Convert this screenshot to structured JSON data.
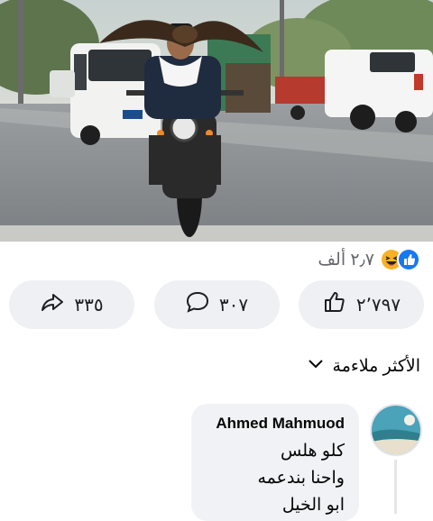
{
  "post_photo": {
    "alt_subject": "man-on-motorcycle-with-eagle",
    "colors": {
      "road": "#8a8f94",
      "sky": "#b9c7c9",
      "trees": "#5f7a4e"
    }
  },
  "reactions": {
    "count": "٢٫٧ ألف",
    "icons": [
      "like-reaction-icon",
      "haha-reaction-icon"
    ]
  },
  "actions": {
    "like_count": "٢٬٧٩٧",
    "comment_count": "٣٠٧",
    "share_count": "٣٣٥"
  },
  "sort": {
    "label": "الأكثر ملاءمة"
  },
  "comment": {
    "author": "Ahmed Mahmuod",
    "lines": [
      "كلو هلس",
      "واحنا بندعمه",
      "ابو الخيل"
    ]
  },
  "colors": {
    "accent": "#1877f2",
    "button_bg": "#eef0f3",
    "bubble_bg": "#f0f2f5",
    "haha": "#f7b125"
  }
}
